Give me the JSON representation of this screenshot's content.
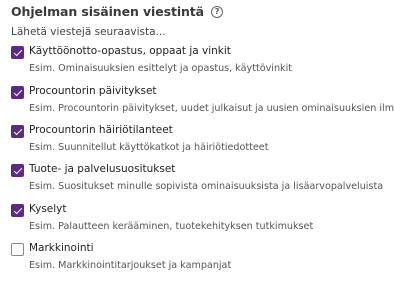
{
  "section": {
    "title": "Ohjelman sisäinen viestintä",
    "help_icon": "question-circle-icon",
    "intro": "Lähetä viestejä seuraavista..."
  },
  "accent_color": "#5b2a86",
  "options": [
    {
      "label": "Käyttöönotto-opastus, oppaat ja vinkit",
      "description": "Esim. Ominaisuuksien esittelyt ja opastus, käyttövinkit",
      "checked": true
    },
    {
      "label": "Procountorin päivitykset",
      "description": "Esim. Procountorin päivitykset, uudet julkaisut ja uusien ominaisuuksien ilmoitu",
      "checked": true
    },
    {
      "label": "Procountorin häiriötilanteet",
      "description": "Esim. Suunnitellut käyttökatkot ja häiriötiedotteet",
      "checked": true
    },
    {
      "label": "Tuote- ja palvelusuositukset",
      "description": "Esim. Suositukset minulle sopivista ominaisuuksista ja lisäarvopalveluista",
      "checked": true
    },
    {
      "label": "Kyselyt",
      "description": "Esim. Palautteen kerääminen, tuotekehityksen tutkimukset",
      "checked": true
    },
    {
      "label": "Markkinointi",
      "description": "Esim. Markkinointitarjoukset ja kampanjat",
      "checked": false
    }
  ]
}
